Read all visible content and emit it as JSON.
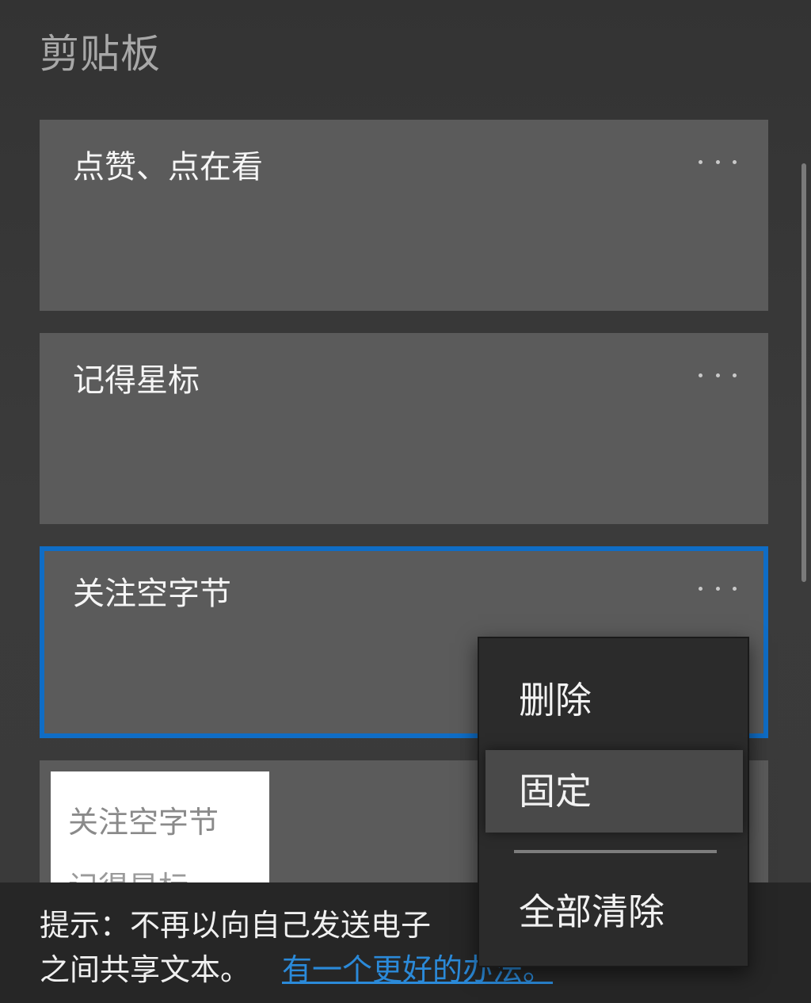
{
  "panel": {
    "title": "剪贴板"
  },
  "clips": [
    {
      "text": "点赞、点在看",
      "more_label": "···"
    },
    {
      "text": "记得星标",
      "more_label": "···"
    },
    {
      "text": "关注空字节",
      "more_label": "···",
      "selected": true
    }
  ],
  "image_clip": {
    "thumb_lines": [
      "关注空字节",
      "记得星标"
    ]
  },
  "tip": {
    "line1": "提示：不再以向自己发送电子",
    "line2": "之间共享文本。",
    "link": "有一个更好的办法。"
  },
  "context_menu": {
    "items": [
      {
        "label": "删除"
      },
      {
        "label": "固定",
        "highlighted": true
      },
      {
        "label": "全部清除"
      }
    ]
  },
  "colors": {
    "accent": "#0f6dc6",
    "link": "#2b8ad9",
    "card": "#5b5b5b",
    "menu": "#2b2b2b"
  }
}
